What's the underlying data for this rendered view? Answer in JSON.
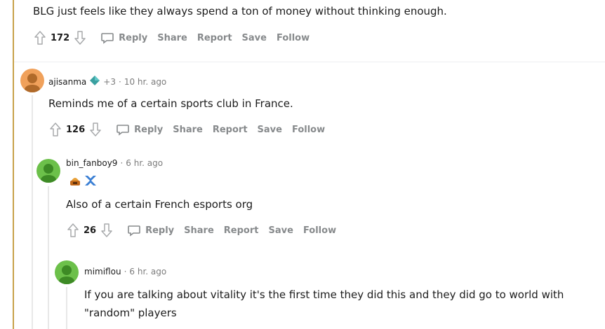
{
  "top_comment": {
    "text": "BLG just feels like they always spend a ton of money without thinking enough.",
    "score": "172"
  },
  "actions": {
    "reply": "Reply",
    "share": "Share",
    "report": "Report",
    "save": "Save",
    "follow": "Follow"
  },
  "comments": [
    {
      "username": "ajisanma",
      "extra": "+3",
      "separator": "·",
      "time": "10 hr. ago",
      "text": "Reminds me of a certain sports club in France.",
      "score": "126"
    },
    {
      "username": "bin_fanboy9",
      "separator": "·",
      "time": "6 hr. ago",
      "text": "Also of a certain French esports org",
      "score": "26"
    },
    {
      "username": "mimiflou",
      "separator": "·",
      "time": "6 hr. ago",
      "text_line1": "If you are talking about vitality it's the first time they did this and they did go to world with",
      "text_line2": "\"random\" players"
    }
  ],
  "colors": {
    "gold_thread": "#c8a24a",
    "avatar_orange": "#f0a15b",
    "avatar_green": "#6cc04a",
    "diamond": "#3aa0a0"
  },
  "icons": [
    "upvote-icon",
    "downvote-icon",
    "comment-icon",
    "diamond-icon",
    "flair-icon"
  ]
}
